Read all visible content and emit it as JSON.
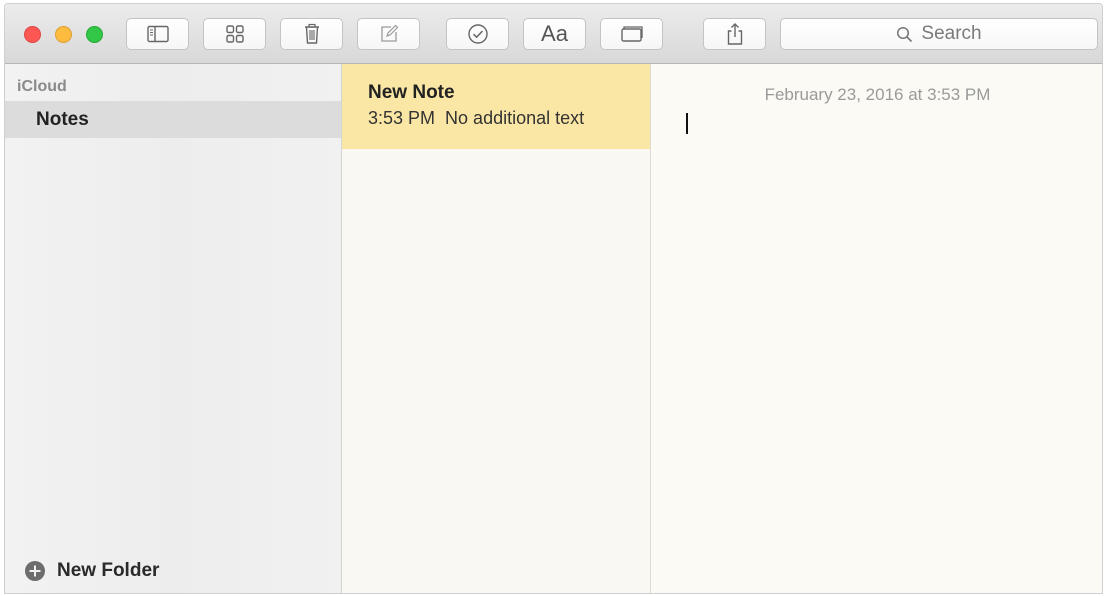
{
  "toolbar": {
    "buttons": [
      {
        "name": "toggle-sidebar",
        "icon": "sidebar-icon"
      },
      {
        "name": "attachments-browser",
        "icon": "grid-icon"
      },
      {
        "name": "delete-note",
        "icon": "trash-icon"
      },
      {
        "name": "new-note",
        "icon": "compose-icon"
      },
      {
        "name": "checklist",
        "icon": "checkmark-circle-icon"
      },
      {
        "name": "format",
        "icon": "text-format-icon",
        "label": "Aa"
      },
      {
        "name": "add-table",
        "icon": "table-icon"
      },
      {
        "name": "share",
        "icon": "share-icon"
      }
    ],
    "search": {
      "placeholder": "Search",
      "icon": "search-icon"
    }
  },
  "sidebar": {
    "account_label": "iCloud",
    "folders": [
      {
        "label": "Notes",
        "selected": true
      }
    ],
    "new_folder_label": "New Folder"
  },
  "note_list": {
    "notes": [
      {
        "title": "New Note",
        "time": "3:53 PM",
        "preview": "No additional text",
        "selected": true
      }
    ]
  },
  "editor": {
    "date": "February 23, 2016 at 3:53 PM"
  },
  "colors": {
    "close": "#fc5753",
    "minimize": "#fdbc40",
    "maximize": "#33c748",
    "selected_note": "#fae7a5",
    "selected_folder": "#dcdcdc"
  }
}
